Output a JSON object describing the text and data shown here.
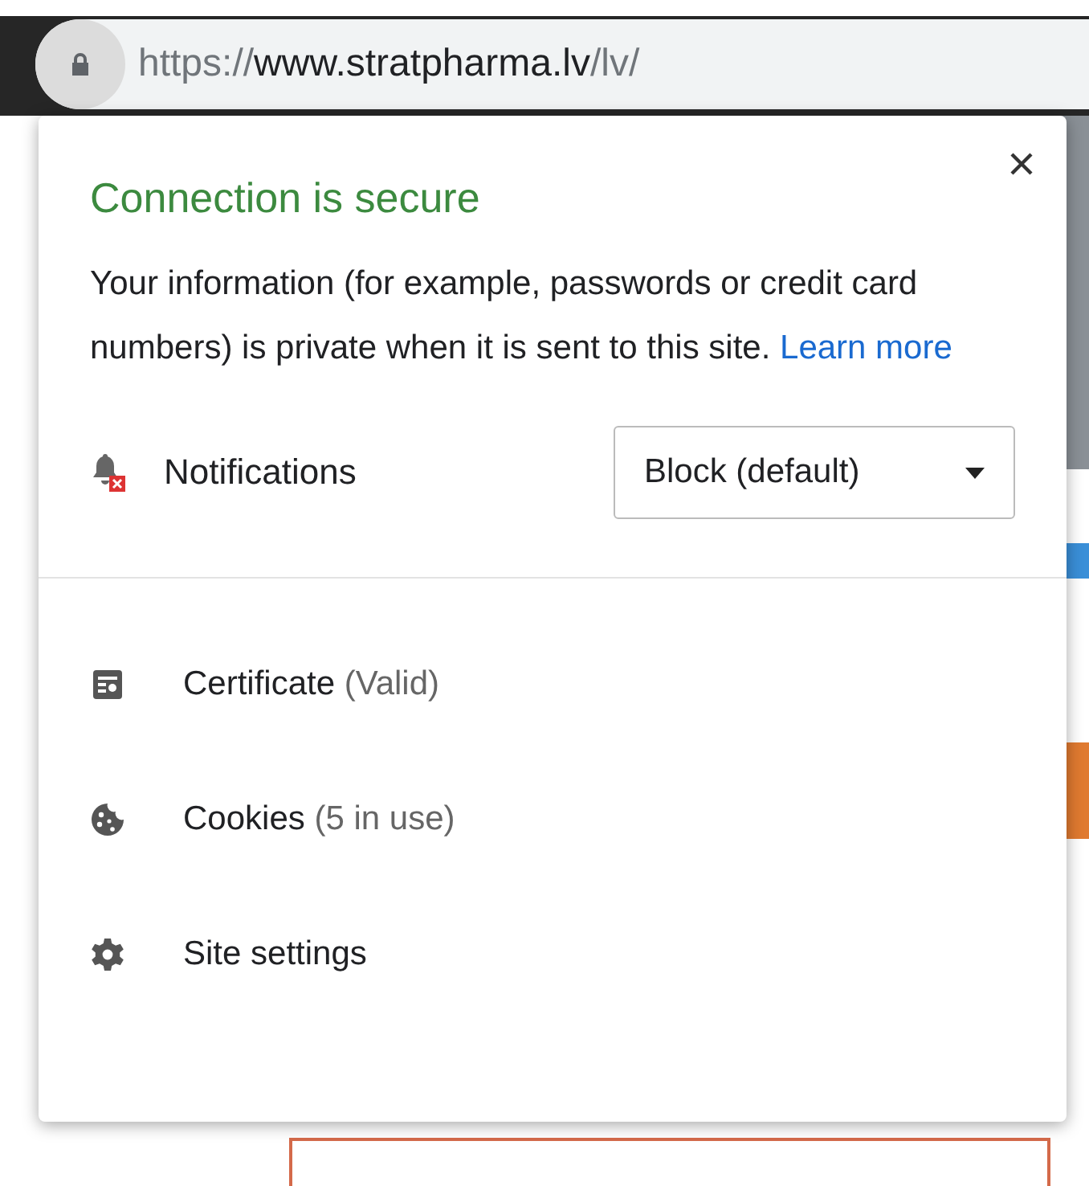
{
  "address_bar": {
    "scheme": "https://",
    "host": "www.stratpharma.lv",
    "path": "/lv/"
  },
  "popup": {
    "title": "Connection is secure",
    "body": "Your information (for example, passwords or credit card numbers) is private when it is sent to this site.",
    "link": "Learn more",
    "permission": {
      "label": "Notifications",
      "value": "Block (default)"
    },
    "items": [
      {
        "kind": "certificate",
        "label": "Certificate",
        "detail": "(Valid)"
      },
      {
        "kind": "cookies",
        "label": "Cookies",
        "detail": "(5 in use)"
      },
      {
        "kind": "settings",
        "label": "Site settings"
      }
    ]
  }
}
